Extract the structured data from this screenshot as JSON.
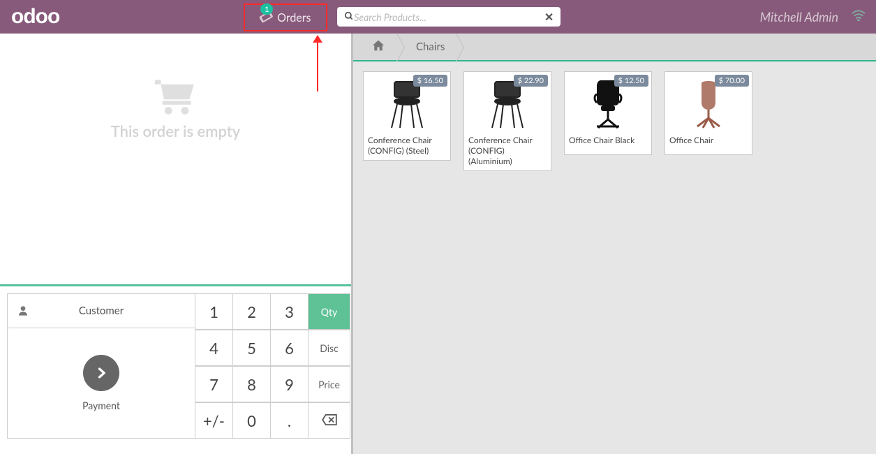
{
  "topbar": {
    "logo_text": "odoo",
    "orders_label": "Orders",
    "orders_badge": "1",
    "search_placeholder": "Search Products...",
    "username": "Mitchell Admin"
  },
  "cart": {
    "empty_message": "This order is empty"
  },
  "actionpad": {
    "customer_label": "Customer",
    "payment_label": "Payment"
  },
  "numpad": {
    "k1": "1",
    "k2": "2",
    "k3": "3",
    "k4": "4",
    "k5": "5",
    "k6": "6",
    "k7": "7",
    "k8": "8",
    "k9": "9",
    "kpm": "+/-",
    "k0": "0",
    "kdot": ".",
    "qty": "Qty",
    "disc": "Disc",
    "price": "Price"
  },
  "breadcrumb": {
    "home_icon": "home-icon",
    "category": "Chairs"
  },
  "products": [
    {
      "name": "Conference Chair (CONFIG) (Steel)",
      "price": "$ 16.50"
    },
    {
      "name": "Conference Chair (CONFIG) (Aluminium)",
      "price": "$ 22.90"
    },
    {
      "name": "Office Chair Black",
      "price": "$ 12.50"
    },
    {
      "name": "Office Chair",
      "price": "$ 70.00"
    }
  ]
}
